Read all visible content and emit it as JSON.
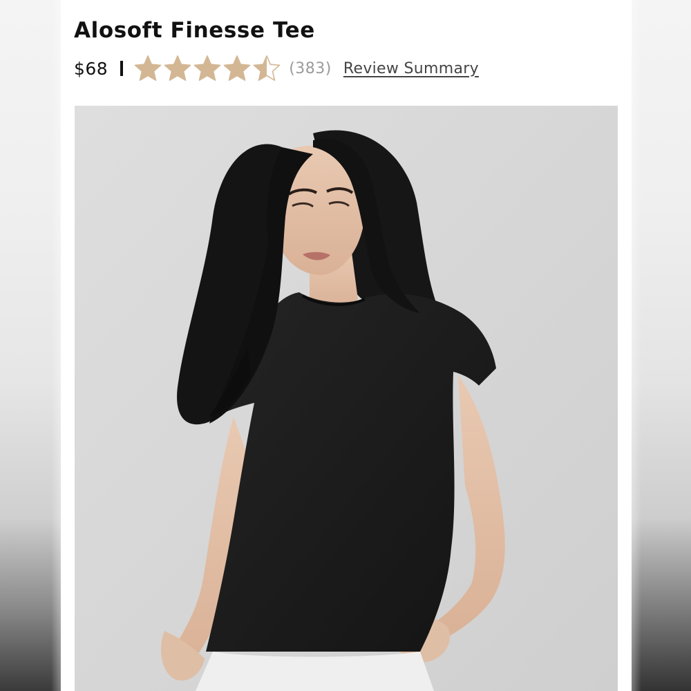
{
  "product": {
    "title": "Alosoft Finesse Tee",
    "price": "$68",
    "rating": {
      "value": 4.5,
      "max": 5,
      "count_text": "(383)",
      "star_color": "#d3b794"
    },
    "review_link_label": "Review Summary"
  },
  "image": {
    "icon": "product-photo"
  },
  "colors": {
    "text": "#111111",
    "muted": "#9a9a9a",
    "photo_background": "#d6d6d6",
    "tee": "#1b1b1b"
  }
}
